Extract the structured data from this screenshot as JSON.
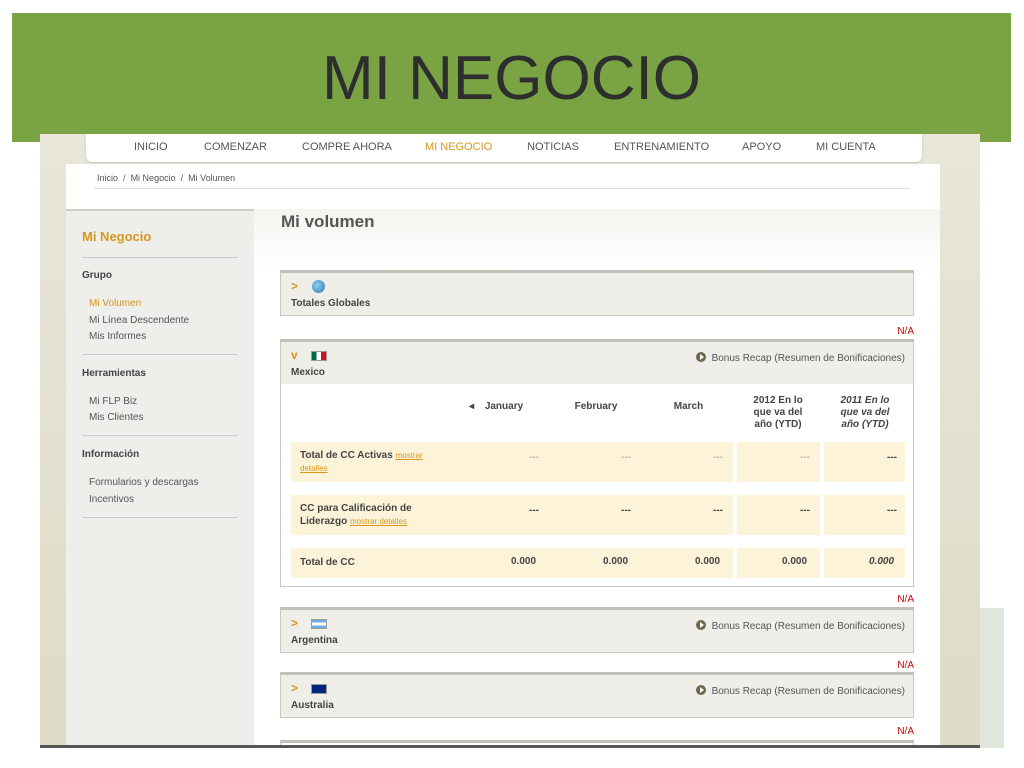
{
  "slide": {
    "title": "MI NEGOCIO"
  },
  "colors": {
    "banner": "#7aa444",
    "accent": "#d8961c",
    "error": "#cc0000"
  },
  "nav": {
    "items": [
      "INICIO",
      "COMENZAR",
      "COMPRE AHORA",
      "MI NEGOCIO",
      "NOTICIAS",
      "ENTRENAMIENTO",
      "APOYO",
      "MI CUENTA"
    ],
    "active": "MI NEGOCIO"
  },
  "breadcrumb": [
    "Inicio",
    "Mi Negocio",
    "Mi Volumen"
  ],
  "breadcrumb_sep": "/",
  "sidebar": {
    "title": "Mi Negocio",
    "sections": [
      {
        "heading": "Grupo",
        "links": [
          "Mi Volumen",
          "Mi Línea Descendente",
          "Mis Informes"
        ]
      },
      {
        "heading": "Herramientas",
        "links": [
          "Mi FLP Biz",
          "Mis Clientes"
        ]
      },
      {
        "heading": "Información",
        "links": [
          "Formularios y descargas",
          "Incentivos"
        ]
      }
    ],
    "active": "Mi Volumen"
  },
  "content": {
    "title": "Mi volumen",
    "na": "N/A",
    "bonus_label": "Bonus Recap (Resumen de Bonificaciones)",
    "panels": {
      "global": {
        "name": "Totales Globales",
        "icon": "globe-icon",
        "chevron": ">"
      },
      "mexico": {
        "name": "Mexico",
        "chevron": "v"
      },
      "argentina": {
        "name": "Argentina",
        "chevron": ">"
      },
      "australia": {
        "name": "Australia",
        "chevron": ">"
      }
    },
    "table": {
      "sort_icon": "◂",
      "columns": [
        "January",
        "February",
        "March",
        "2012 En lo que va del año (YTD)",
        "2011 En lo que va del año (YTD)"
      ],
      "detail_link": "mostrar detalles",
      "rows": [
        {
          "label": "Total de CC Activas",
          "has_link": true,
          "values": [
            "---",
            "---",
            "---",
            "---",
            "---"
          ]
        },
        {
          "label": "CC para Calificación de Liderazgo",
          "has_link": true,
          "values": [
            "---",
            "---",
            "---",
            "---",
            "---"
          ]
        },
        {
          "label": "Total de CC",
          "has_link": false,
          "values": [
            "0.000",
            "0.000",
            "0.000",
            "0.000",
            "0.000"
          ]
        }
      ]
    }
  }
}
